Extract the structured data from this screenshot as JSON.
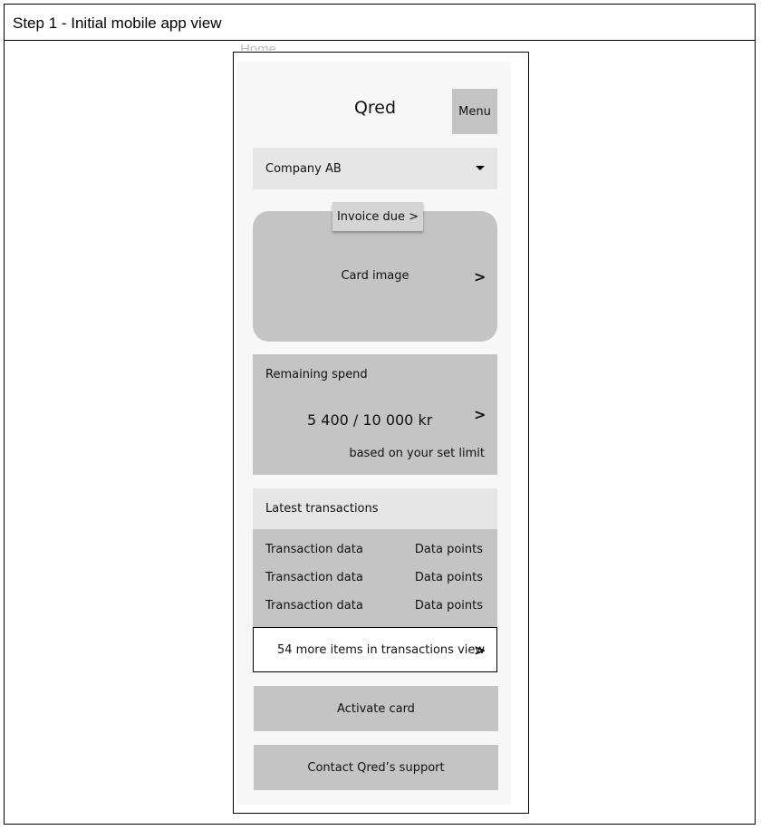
{
  "step_title": "Step 1 - Initial mobile app view",
  "home_label": "Home",
  "app": {
    "title": "Qred",
    "menu_label": "Menu"
  },
  "company_select": {
    "value": "Company AB"
  },
  "card": {
    "invoice_badge": "Invoice due >",
    "image_label": "Card image",
    "chevron": ">"
  },
  "spend": {
    "label": "Remaining spend",
    "value": "5 400 / 10 000 kr",
    "note": "based on your set limit",
    "chevron": ">"
  },
  "transactions": {
    "heading": "Latest transactions",
    "rows": [
      {
        "name": "Transaction data",
        "value": "Data points"
      },
      {
        "name": "Transaction data",
        "value": "Data points"
      },
      {
        "name": "Transaction data",
        "value": "Data points"
      }
    ],
    "more_label": "54 more items in transactions view",
    "more_chevron": ">"
  },
  "actions": {
    "activate_label": "Activate card",
    "support_label": "Contact Qred’s support"
  }
}
